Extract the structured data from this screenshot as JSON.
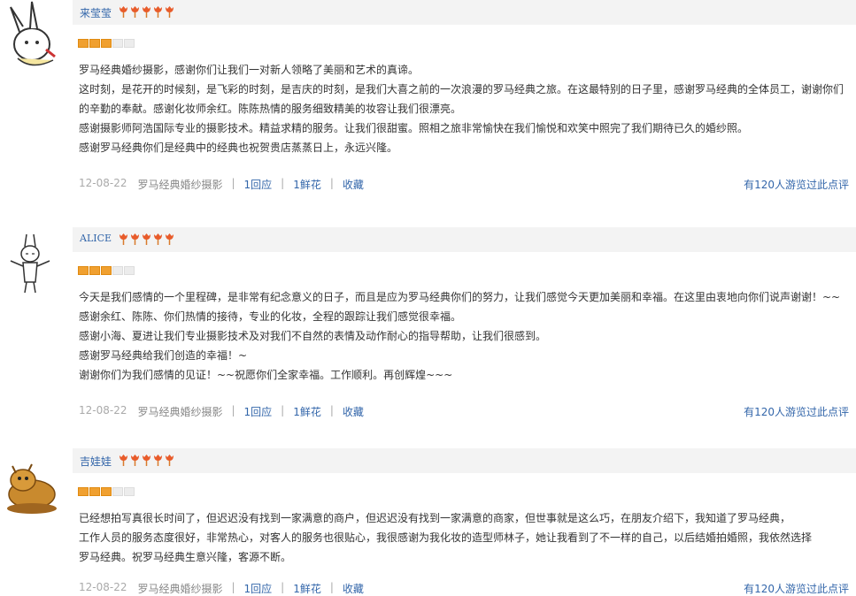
{
  "reviews": [
    {
      "name": "来莹莹",
      "flowers": 5,
      "rating": 3,
      "lines": [
        "罗马经典婚纱摄影，感谢你们让我们一对新人领略了美丽和艺术的真谛。",
        "这时刻，是花开的时候刻，是飞彩的时刻，是吉庆的时刻，是我们大喜之前的一次浪漫的罗马经典之旅。在这最特别的日子里，感谢罗马经典的全体员工，谢谢你们",
        "的辛勤的奉献。感谢化妆师余红。陈陈热情的服务细致精美的妆容让我们很漂亮。",
        "感谢摄影师阿浩国际专业的摄影技术。精益求精的服务。让我们很甜蜜。照相之旅非常愉快在我们愉悦和欢笑中照完了我们期待已久的婚纱照。",
        "感谢罗马经典你们是经典中的经典也祝贺贵店蒸蒸日上，永远兴隆。"
      ],
      "date": "12-08-22",
      "category": "罗马经典婚纱摄影",
      "reply": "1回应",
      "flower_link": "1鲜花",
      "favorite": "收藏",
      "visits": "有120人游览过此点评"
    },
    {
      "name": "ALICE",
      "flowers": 5,
      "rating": 3,
      "lines": [
        "今天是我们感情的一个里程碑，是非常有纪念意义的日子，而且是应为罗马经典你们的努力，让我们感觉今天更加美丽和幸福。在这里由衷地向你们说声谢谢！~~",
        "感谢余红、陈陈、你们热情的接待，专业的化妆，全程的跟踪让我们感觉很幸福。",
        "感谢小海、夏进让我们专业摄影技术及对我们不自然的表情及动作耐心的指导帮助，让我们很感到。",
        "感谢罗马经典给我们创造的幸福！~",
        "谢谢你们为我们感情的见证！~~祝愿你们全家幸福。工作顺利。再创辉煌~~~"
      ],
      "date": "12-08-22",
      "category": "罗马经典婚纱摄影",
      "reply": "1回应",
      "flower_link": "1鲜花",
      "favorite": "收藏",
      "visits": "有120人游览过此点评"
    },
    {
      "name": "吉娃娃",
      "flowers": 5,
      "rating": 3,
      "lines": [
        "已经想拍写真很长时间了，但迟迟没有找到一家满意的商户，但迟迟没有找到一家满意的商家，但世事就是这么巧，在朋友介绍下，我知道了罗马经典，",
        "工作人员的服务态度很好，非常热心，对客人的服务也很贴心，我很感谢为我化妆的造型师林子，她让我看到了不一样的自己，以后结婚拍婚照，我依然选择",
        "罗马经典。祝罗马经典生意兴隆，客源不断。"
      ],
      "date": "12-08-22",
      "category": "罗马经典婚纱摄影",
      "reply": "1回应",
      "flower_link": "1鲜花",
      "favorite": "收藏",
      "visits": "有120人游览过此点评"
    }
  ]
}
